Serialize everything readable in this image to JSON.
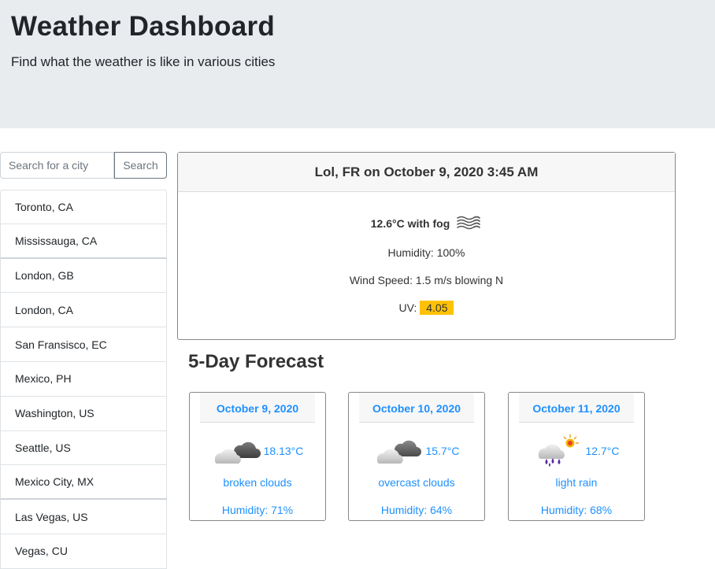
{
  "header": {
    "title": "Weather Dashboard",
    "subtitle": "Find what the weather is like in various cities"
  },
  "search": {
    "placeholder": "Search for a city",
    "button_label": "Search"
  },
  "cities": [
    "Toronto, CA",
    "Mississauga, CA",
    "London, GB",
    "London, CA",
    "San Fransisco, EC",
    "Mexico, PH",
    "Washington, US",
    "Seattle, US",
    "Mexico City, MX",
    "Las Vegas, US",
    "Vegas, CU"
  ],
  "current": {
    "heading": "Lol, FR on October 9, 2020 3:45 AM",
    "condition": "12.6°C with fog",
    "condition_icon": "fog-icon",
    "humidity": "Humidity: 100%",
    "wind": "Wind Speed: 1.5 m/s blowing N",
    "uv_label": "UV:",
    "uv_value": "4.05",
    "uv_color": "#ffc107"
  },
  "forecast": {
    "title": "5-Day Forecast",
    "days": [
      {
        "date": "October 9, 2020",
        "icon": "broken-clouds-icon",
        "temp": "18.13°C",
        "desc": "broken clouds",
        "humidity": "Humidity: 71%"
      },
      {
        "date": "October 10, 2020",
        "icon": "overcast-clouds-icon",
        "temp": "15.7°C",
        "desc": "overcast clouds",
        "humidity": "Humidity: 64%"
      },
      {
        "date": "October 11, 2020",
        "icon": "light-rain-icon",
        "temp": "12.7°C",
        "desc": "light rain",
        "humidity": "Humidity: 68%"
      }
    ]
  },
  "colors": {
    "accent": "#1e90ff",
    "jumbotron": "#e9ecef"
  }
}
